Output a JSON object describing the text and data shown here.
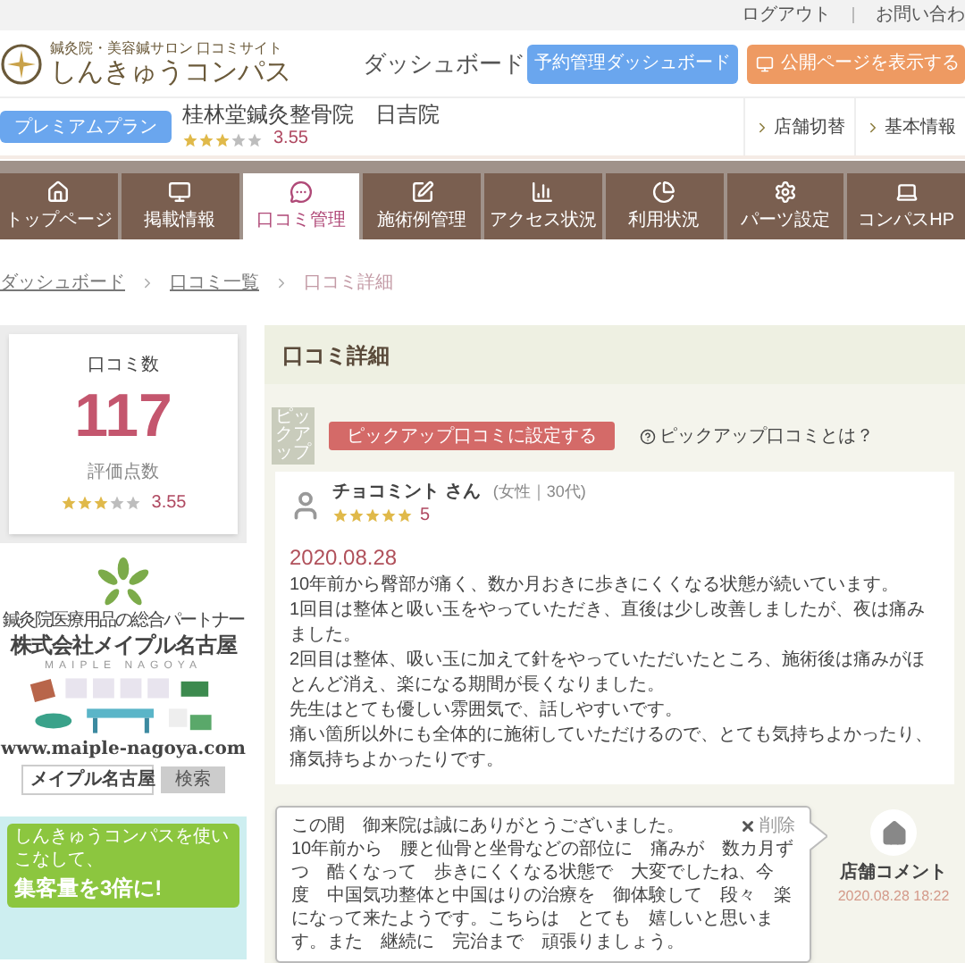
{
  "top_links": [
    "ログアウト",
    "お問い合わ"
  ],
  "header": {
    "tagline": "鍼灸院・美容鍼サロン 口コミサイト",
    "logo_name": "しんきゅうコンパス",
    "page_title": "ダッシュボード",
    "buttons": [
      {
        "label": "予約管理ダッシュボード",
        "kind": "primary"
      },
      {
        "label": "公開ページを表示する",
        "kind": "public"
      }
    ]
  },
  "clinic": {
    "plan": "プレミアムプラン",
    "name": "桂林堂鍼灸整骨院　日吉院",
    "stars": 3,
    "rating": "3.55",
    "links": [
      "店舗切替",
      "基本情報"
    ]
  },
  "nav": [
    {
      "label": "トップページ",
      "selected": false
    },
    {
      "label": "掲載情報",
      "selected": false
    },
    {
      "label": "口コミ管理",
      "selected": true
    },
    {
      "label": "施術例管理",
      "selected": false
    },
    {
      "label": "アクセス状況",
      "selected": false
    },
    {
      "label": "利用状況",
      "selected": false
    },
    {
      "label": "パーツ設定",
      "selected": false
    },
    {
      "label": "コンパスHP",
      "selected": false
    }
  ],
  "breadcrumb": [
    {
      "label": "ダッシュボード",
      "current": false
    },
    {
      "label": "口コミ一覧",
      "current": false
    },
    {
      "label": "口コミ詳細",
      "current": true
    }
  ],
  "sidebar": {
    "count_label": "口コミ数",
    "count": "117",
    "rating_label": "評価点数",
    "stars": 3,
    "rating": "3.55",
    "ad": {
      "tagline": "鍼灸院医療用品の総合パートナー",
      "company": "株式会社メイプル名古屋",
      "romaji": "MAIPLE NAGOYA",
      "url": "www.maiple-nagoya.com",
      "search_value": "メイプル名古屋",
      "search_button": "検索"
    },
    "banner": {
      "line_1": "しんきゅうコンパスを使いこなして、",
      "line_2": "集客量を3倍に!"
    }
  },
  "panel": {
    "title": "口コミ詳細",
    "pickup_badge": "ピックアップ",
    "pickup_button": "ピックアップ口コミに設定する",
    "pickup_help": "ピックアップ口コミとは？",
    "review": {
      "name": "チョコミント さん",
      "meta": "(女性｜30代)",
      "stars": 5,
      "score": "5",
      "date": "2020.08.28",
      "paragraphs": [
        "10年前から臀部が痛く、数か月おきに歩きにくくなる状態が続いています。",
        "1回目は整体と吸い玉をやっていただき、直後は少し改善しましたが、夜は痛みました。",
        "2回目は整体、吸い玉に加えて針をやっていただいたところ、施術後は痛みがほとんど消え、楽になる期間が長くなりました。",
        "先生はとても優しい雰囲気で、話しやすいです。",
        "痛い箇所以外にも全体的に施術していただけるので、とても気持ちよかったり、痛気持ちよかったりです。"
      ]
    },
    "comment": {
      "greeting": "この間　御来院は誠にありがとうございました。",
      "text": "10年前から　腰と仙骨と坐骨などの部位に　痛みが　数カ月ずつ　酷くなって　歩きにくくなる状態で　大変でしたね、今度　中国気功整体と中国はりの治療を　御体験して　段々　楽になって来たようです。こちらは　とても　嬉しいと思います。また　継続に　完治まで　頑張りましょう。",
      "delete": "削除",
      "label": "店舗コメント",
      "time": "2020.08.28 18:22"
    }
  }
}
